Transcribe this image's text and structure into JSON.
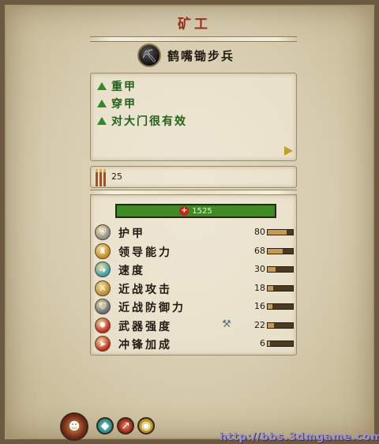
{
  "title": "矿工",
  "unit": {
    "name": "鹤嘴锄步兵",
    "icon": "pickaxe-icon"
  },
  "traits": [
    {
      "label": "重甲"
    },
    {
      "label": "穿甲"
    },
    {
      "label": "对大门很有效"
    }
  ],
  "men_count": "25",
  "hp": "1525",
  "stats": [
    {
      "id": "armor",
      "label": "护甲",
      "value": "80",
      "level": 0.75,
      "icon": "armor-icon",
      "color": "#8a8a8a"
    },
    {
      "id": "leadership",
      "label": "领导能力",
      "value": "68",
      "level": 0.6,
      "icon": "leadership-icon",
      "color": "#c48a1e"
    },
    {
      "id": "speed",
      "label": "速度",
      "value": "30",
      "level": 0.3,
      "icon": "speed-icon",
      "color": "#2e9bb0"
    },
    {
      "id": "melee-attack",
      "label": "近战攻击",
      "value": "18",
      "level": 0.22,
      "icon": "melee-attack-icon",
      "color": "#b8892a"
    },
    {
      "id": "melee-defence",
      "label": "近战防御力",
      "value": "16",
      "level": 0.2,
      "icon": "melee-defence-icon",
      "color": "#5a6a7a"
    },
    {
      "id": "weapon-strength",
      "label": "武器强度",
      "value": "22",
      "level": 0.26,
      "icon": "weapon-strength-icon",
      "color": "#c0241c"
    },
    {
      "id": "charge-bonus",
      "label": "冲锋加成",
      "value": "6",
      "level": 0.08,
      "icon": "charge-bonus-icon",
      "color": "#c0241c"
    }
  ],
  "bottom_buttons": [
    {
      "id": "unit-card",
      "icon": "unit-card-icon",
      "color": "#7a2a1c"
    },
    {
      "id": "ability-1",
      "icon": "shield-ability-icon",
      "color": "#2e8b8b"
    },
    {
      "id": "ability-2",
      "icon": "arrow-ability-icon",
      "color": "#a3261c"
    },
    {
      "id": "ability-3",
      "icon": "eye-ability-icon",
      "color": "#b8901e"
    }
  ],
  "watermark": "http://bbs.3dmgame.com"
}
